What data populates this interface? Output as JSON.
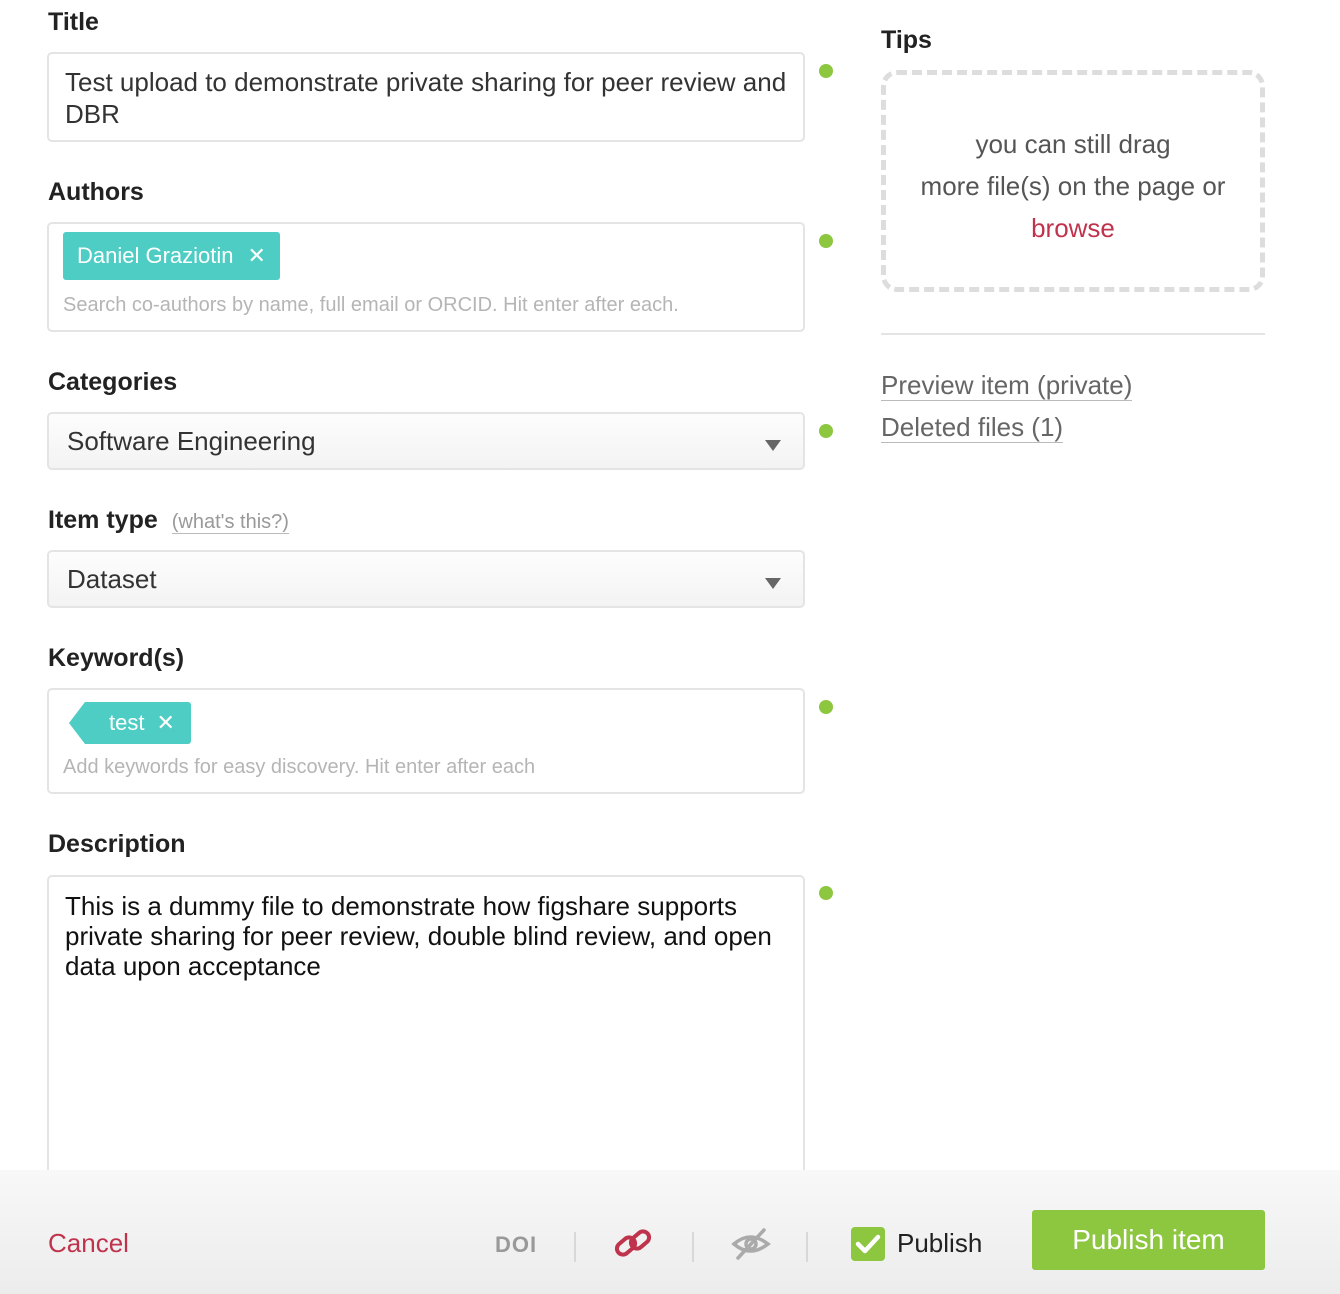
{
  "title": {
    "label": "Title",
    "value": "Test upload to demonstrate private sharing for peer review and DBR"
  },
  "authors": {
    "label": "Authors",
    "tags": [
      "Daniel Graziotin"
    ],
    "placeholder": "Search co-authors by name, full email or ORCID. Hit enter after each."
  },
  "categories": {
    "label": "Categories",
    "selected": "Software Engineering"
  },
  "item_type": {
    "label": "Item type",
    "hint": "(what's this?)",
    "selected": "Dataset"
  },
  "keywords": {
    "label": "Keyword(s)",
    "tags": [
      "test"
    ],
    "placeholder": "Add keywords for easy discovery. Hit enter after each"
  },
  "description": {
    "label": "Description",
    "value": "This is a dummy file to demonstrate how figshare supports private sharing for peer review, double blind review, and open data upon acceptance"
  },
  "sidebar": {
    "tips_title": "Tips",
    "dropzone_line1": "you can still drag",
    "dropzone_line2": "more file(s) on the page or",
    "dropzone_browse": "browse",
    "preview_link": "Preview item (private)",
    "deleted_link": "Deleted files (1)"
  },
  "footer": {
    "cancel": "Cancel",
    "doi": "DOI",
    "publish_checkbox_label": "Publish",
    "publish_button": "Publish item",
    "publish_checked": true
  },
  "colors": {
    "accent_green": "#8dc63f",
    "tag_teal": "#4ecdc4",
    "link_red": "#c0334d"
  },
  "icons": {
    "tag_remove": "close-icon",
    "dropdown": "chevron-down-icon",
    "private_link": "link-icon",
    "hidden": "eye-slash-icon",
    "check": "check-icon"
  }
}
